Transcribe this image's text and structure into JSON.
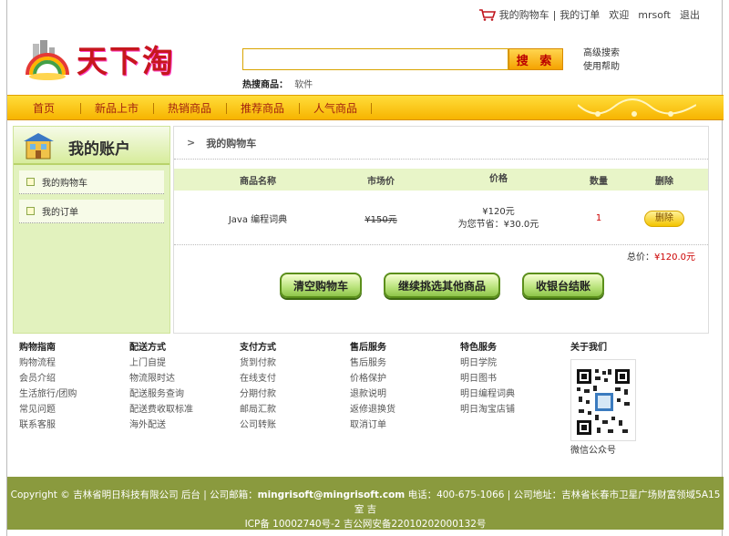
{
  "toplinks": {
    "cart": "我的购物车",
    "sep": "|",
    "orders": "我的订单",
    "welcome": "欢迎",
    "user": "mrsoft",
    "logout": "退出"
  },
  "logo": {
    "text": "天下淘"
  },
  "search": {
    "value": "",
    "button": "搜 索"
  },
  "hot": {
    "label": "热搜商品：",
    "item": "软件"
  },
  "adv": {
    "advanced": "高级搜索",
    "help": "使用帮助"
  },
  "nav": [
    "首页",
    "新品上市",
    "热销商品",
    "推荐商品",
    "人气商品"
  ],
  "sidebar": {
    "title": "我的账户",
    "items": [
      "我的购物车",
      "我的订单"
    ]
  },
  "main": {
    "crumb_arrow": ">",
    "crumb": "我的购物车",
    "columns": [
      "商品名称",
      "市场价",
      "价格",
      "数量",
      "删除"
    ],
    "row": {
      "name": "Java 编程词典",
      "market": "¥150元",
      "price": "¥120元",
      "save": "为您节省：¥30.0元",
      "qty": "1",
      "delete": "删除"
    },
    "total_label": "总价：",
    "total_value": "¥120.0元",
    "buttons": [
      "清空购物车",
      "继续挑选其他商品",
      "收银台结账"
    ]
  },
  "footer": {
    "cols": [
      {
        "title": "购物指南",
        "items": [
          "购物流程",
          "会员介绍",
          "生活旅行/团购",
          "常见问题",
          "联系客服"
        ]
      },
      {
        "title": "配送方式",
        "items": [
          "上门自提",
          "物流限时达",
          "配送服务查询",
          "配送费收取标准",
          "海外配送"
        ]
      },
      {
        "title": "支付方式",
        "items": [
          "货到付款",
          "在线支付",
          "分期付款",
          "邮局汇款",
          "公司转账"
        ]
      },
      {
        "title": "售后服务",
        "items": [
          "售后服务",
          "价格保护",
          "退款说明",
          "返修退换货",
          "取消订单"
        ]
      },
      {
        "title": "特色服务",
        "items": [
          "明日学院",
          "明日图书",
          "明日编程词典",
          "明日淘宝店铺"
        ]
      },
      {
        "title": "关于我们",
        "items": []
      }
    ],
    "qr_caption": "微信公众号",
    "copyright_1": "Copyright © 吉林省明日科技有限公司 后台 | 公司邮箱：",
    "email": "mingrisoft@mingrisoft.com",
    "copyright_2": " 电话：400-675-1066 | 公司地址：吉林省长春市卫星广场财富领域5A15室 吉",
    "copyright_3": "ICP备 10002740号-2 吉公网安备22010202000132号"
  },
  "colors": {
    "nav": "#f7b400",
    "side": "#e2f2be",
    "footer": "#8a9a3e",
    "accent": "#c7161e"
  }
}
